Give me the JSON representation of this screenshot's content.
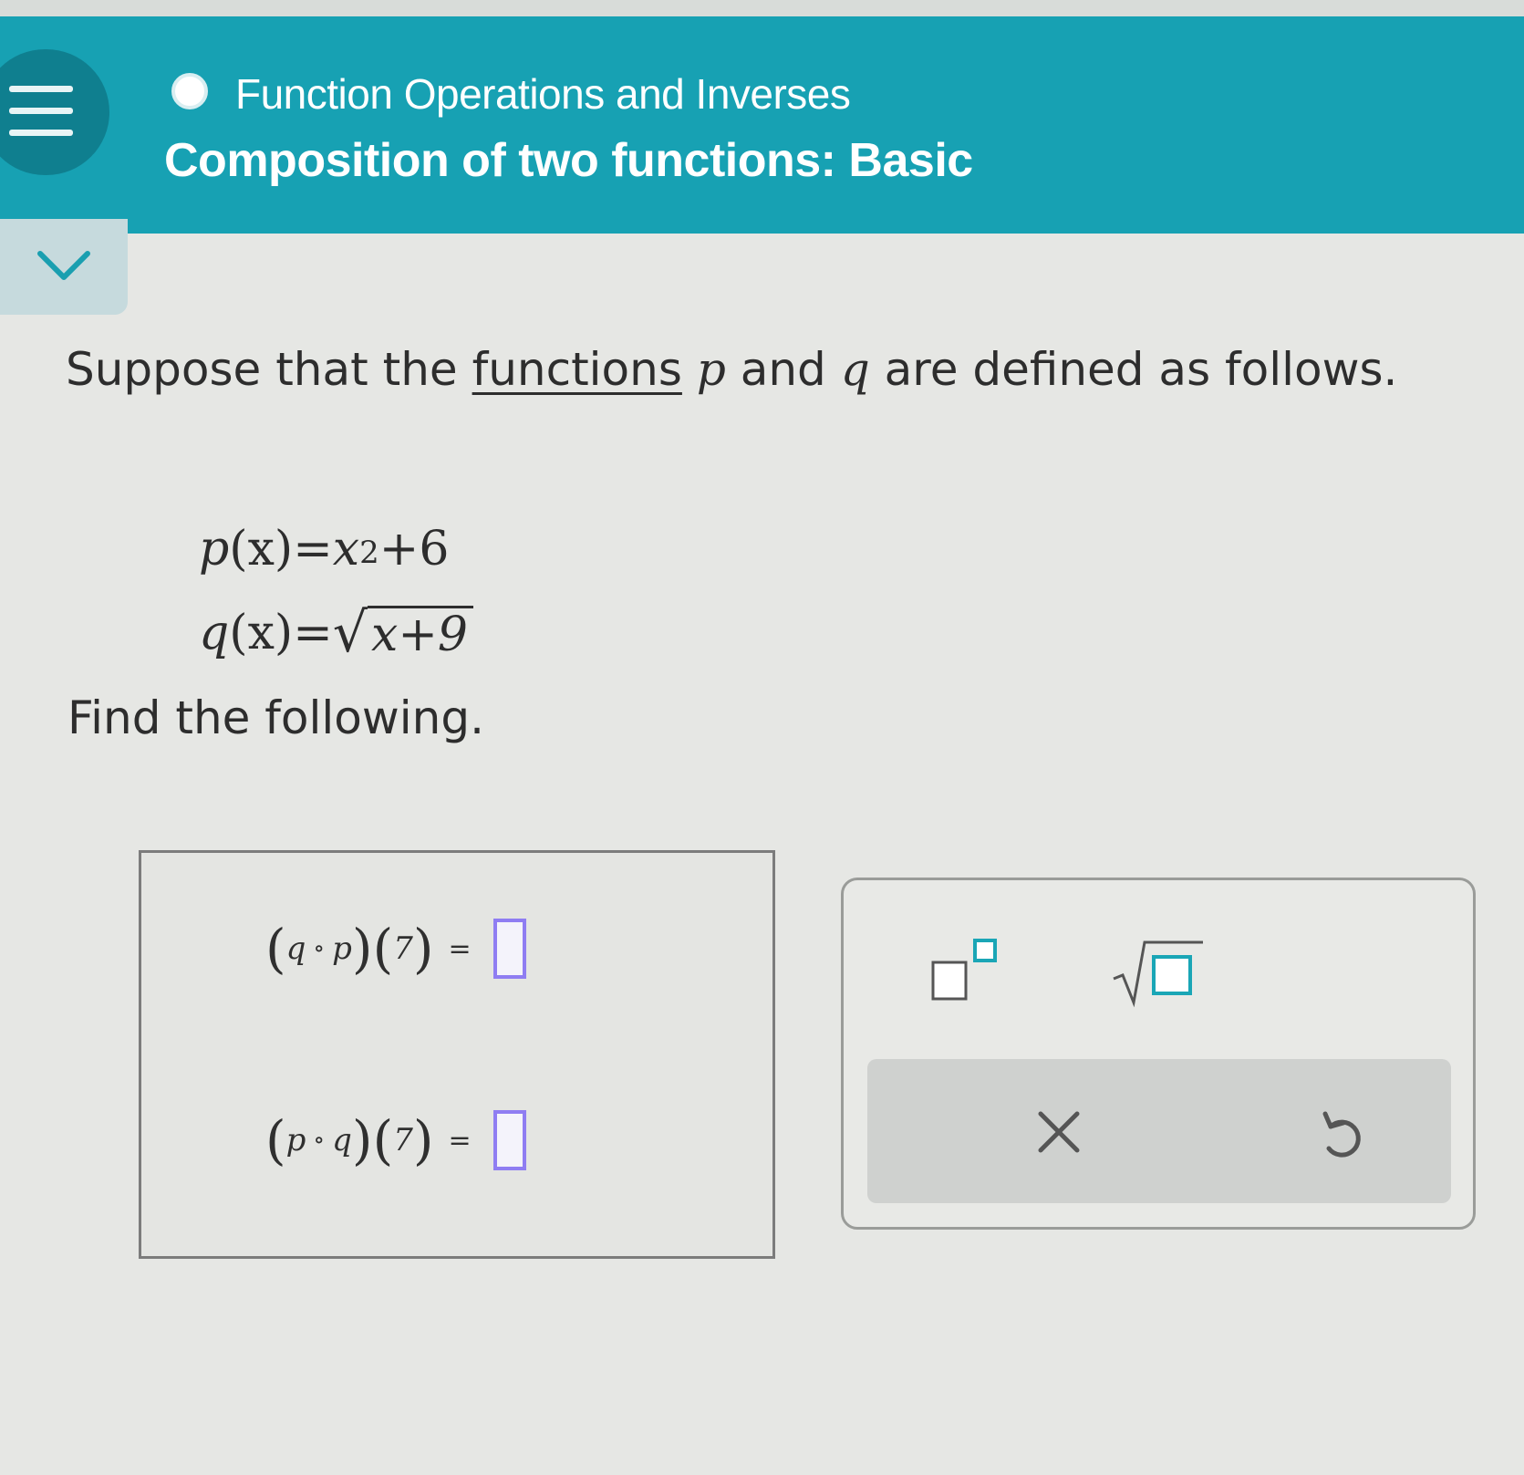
{
  "header": {
    "topic": "Function Operations and Inverses",
    "lesson": "Composition of two functions: Basic",
    "background_color": "#17a1b3"
  },
  "problem": {
    "intro_before": "Suppose that the ",
    "intro_link": "functions",
    "var_p": "p",
    "intro_and": " and ",
    "var_q": "q",
    "intro_after": " are defined as follows.",
    "eq1": {
      "name": "p",
      "arg": "(x)",
      "eq": "=",
      "base": "x",
      "exp": "2",
      "rest": "+6"
    },
    "eq2": {
      "name": "q",
      "arg": "(x)",
      "eq": "=",
      "radicand": "x+9"
    },
    "find": "Find the following."
  },
  "answers": [
    {
      "outer": "q",
      "circ": "∘",
      "inner": "p",
      "arg": "7",
      "equals": "=",
      "value": ""
    },
    {
      "outer": "p",
      "circ": "∘",
      "inner": "q",
      "arg": "7",
      "equals": "=",
      "value": ""
    }
  ],
  "tools": {
    "exponent": "exponent-tool",
    "sqrt": "square-root-tool",
    "clear": "clear",
    "undo": "undo"
  },
  "colors": {
    "input_border": "#8f7df2",
    "tool_accent": "#1aa6b6"
  }
}
